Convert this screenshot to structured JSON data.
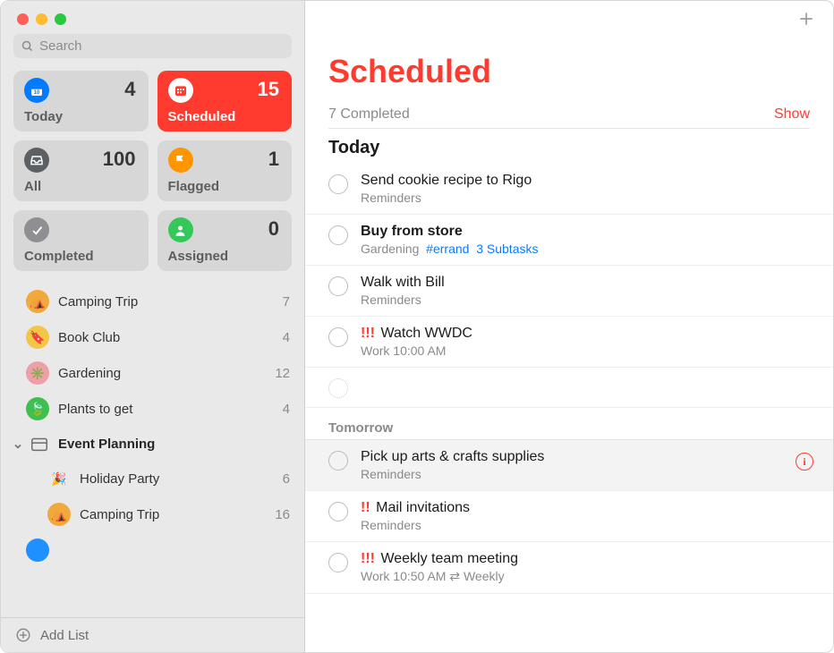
{
  "search": {
    "placeholder": "Search"
  },
  "smartLists": {
    "today": {
      "label": "Today",
      "count": "4"
    },
    "scheduled": {
      "label": "Scheduled",
      "count": "15"
    },
    "all": {
      "label": "All",
      "count": "100"
    },
    "flagged": {
      "label": "Flagged",
      "count": "1"
    },
    "completed": {
      "label": "Completed",
      "count": ""
    },
    "assigned": {
      "label": "Assigned",
      "count": "0"
    }
  },
  "lists": [
    {
      "name": "Camping Trip",
      "count": "7",
      "color": "#f0a93a",
      "emoji": "⛺"
    },
    {
      "name": "Book Club",
      "count": "4",
      "color": "#f4c647",
      "emoji": "🔖"
    },
    {
      "name": "Gardening",
      "count": "12",
      "color": "#eea0a8",
      "emoji": "✳️"
    },
    {
      "name": "Plants to get",
      "count": "4",
      "color": "#3fbf4f",
      "emoji": "🍃"
    }
  ],
  "group": {
    "name": "Event Planning",
    "items": [
      {
        "name": "Holiday Party",
        "count": "6",
        "emoji": "🎉"
      },
      {
        "name": "Camping Trip",
        "count": "16",
        "color": "#f0a93a",
        "emoji": "⛺"
      }
    ]
  },
  "addList": "Add List",
  "main": {
    "title": "Scheduled",
    "completedText": "7 Completed",
    "showLabel": "Show",
    "sections": [
      {
        "heading": "Today",
        "style": "large",
        "items": [
          {
            "title": "Send cookie recipe to Rigo",
            "meta": "Reminders"
          },
          {
            "title": "Buy from store",
            "bold": true,
            "metaList": "Gardening",
            "tag": "#errand",
            "subtasks": "3 Subtasks"
          },
          {
            "title": "Walk with Bill",
            "meta": "Reminders"
          },
          {
            "title": "Watch WWDC",
            "priority": "!!!",
            "meta": "Work  10:00 AM"
          }
        ],
        "hasEmptyRow": true
      },
      {
        "heading": "Tomorrow",
        "style": "small",
        "items": [
          {
            "title": "Pick up arts & crafts supplies",
            "meta": "Reminders",
            "hover": true,
            "info": true
          },
          {
            "title": "Mail invitations",
            "priority": "!!",
            "meta": "Reminders"
          },
          {
            "title": "Weekly team meeting",
            "priority": "!!!",
            "meta": "Work  10:50 AM  ⇄  Weekly"
          }
        ]
      }
    ]
  }
}
